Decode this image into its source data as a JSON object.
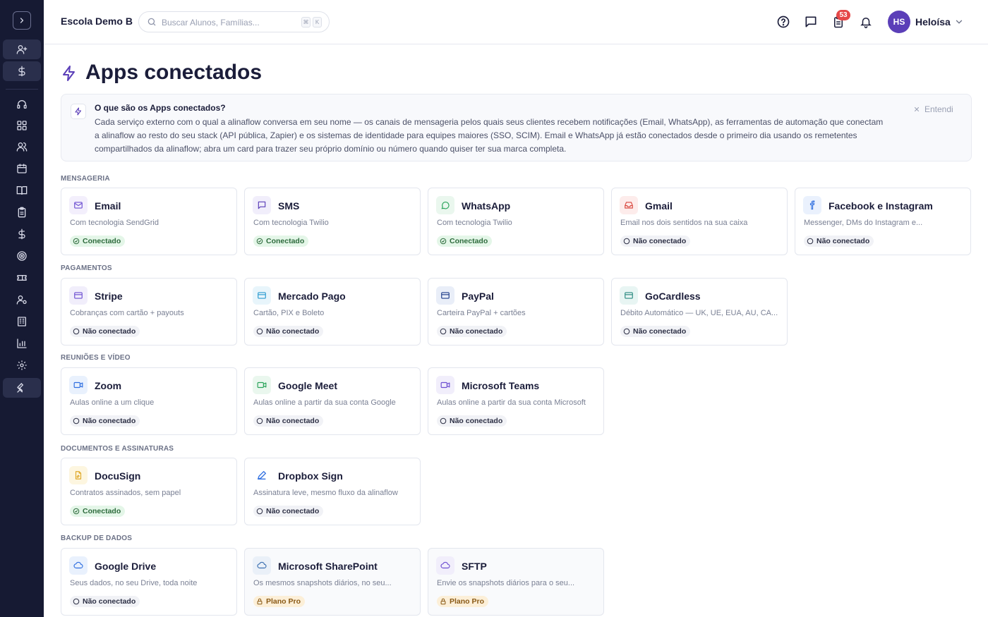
{
  "header": {
    "school_name": "Escola Demo B",
    "search_placeholder": "Buscar Alunos, Famílias...",
    "kbd1": "⌘",
    "kbd2": "K",
    "notification_count": "53",
    "avatar_initials": "HS",
    "user_name": "Heloísa"
  },
  "page": {
    "title": "Apps conectados"
  },
  "info": {
    "title": "O que são os Apps conectados?",
    "body": "Cada serviço externo com o qual a alinaflow conversa em seu nome — os canais de mensageria pelos quais seus clientes recebem notificações (Email, WhatsApp), as ferramentas de automação que conectam a alinaflow ao resto do seu stack (API pública, Zapier) e os sistemas de identidade para equipes maiores (SSO, SCIM). Email e WhatsApp já estão conectados desde o primeiro dia usando os remetentes compartilhados da alinaflow; abra um card para trazer seu próprio domínio ou número quando quiser ter sua marca completa.",
    "dismiss": "Entendi"
  },
  "sections": {
    "mensageria": "MENSAGERIA",
    "pagamentos": "PAGAMENTOS",
    "reunioes": "REUNIÕES E VÍDEO",
    "documentos": "DOCUMENTOS E ASSINATURAS",
    "backup": "BACKUP DE DADOS"
  },
  "status_labels": {
    "connected": "Conectado",
    "not_connected": "Não conectado",
    "pro": "Plano Pro"
  },
  "cards": {
    "email": {
      "name": "Email",
      "desc": "Com tecnologia SendGrid",
      "status": "Conectado"
    },
    "sms": {
      "name": "SMS",
      "desc": "Com tecnologia Twilio",
      "status": "Conectado"
    },
    "whatsapp": {
      "name": "WhatsApp",
      "desc": "Com tecnologia Twilio",
      "status": "Conectado"
    },
    "gmail": {
      "name": "Gmail",
      "desc": "Email nos dois sentidos na sua caixa",
      "status": "Não conectado"
    },
    "facebook": {
      "name": "Facebook e Instagram",
      "desc": "Messenger, DMs do Instagram e...",
      "status": "Não conectado"
    },
    "stripe": {
      "name": "Stripe",
      "desc": "Cobranças com cartão + payouts",
      "status": "Não conectado"
    },
    "mercado": {
      "name": "Mercado Pago",
      "desc": "Cartão, PIX e Boleto",
      "status": "Não conectado"
    },
    "paypal": {
      "name": "PayPal",
      "desc": "Carteira PayPal + cartões",
      "status": "Não conectado"
    },
    "gocardless": {
      "name": "GoCardless",
      "desc": "Débito Automático — UK, UE, EUA, AU, CA...",
      "status": "Não conectado"
    },
    "zoom": {
      "name": "Zoom",
      "desc": "Aulas online a um clique",
      "status": "Não conectado"
    },
    "meet": {
      "name": "Google Meet",
      "desc": "Aulas online a partir da sua conta Google",
      "status": "Não conectado"
    },
    "teams": {
      "name": "Microsoft Teams",
      "desc": "Aulas online a partir da sua conta Microsoft",
      "status": "Não conectado"
    },
    "docusign": {
      "name": "DocuSign",
      "desc": "Contratos assinados, sem papel",
      "status": "Conectado"
    },
    "dropbox": {
      "name": "Dropbox Sign",
      "desc": "Assinatura leve, mesmo fluxo da alinaflow",
      "status": "Não conectado"
    },
    "gdrive": {
      "name": "Google Drive",
      "desc": "Seus dados, no seu Drive, toda noite",
      "status": "Não conectado"
    },
    "sharepoint": {
      "name": "Microsoft SharePoint",
      "desc": "Os mesmos snapshots diários, no seu...",
      "status": "Plano Pro"
    },
    "sftp": {
      "name": "SFTP",
      "desc": "Envie os snapshots diários para o seu...",
      "status": "Plano Pro"
    }
  },
  "colors": {
    "sidebar_bg": "#161a33",
    "accent": "#5b3fb8",
    "connected_bg": "#e4f6e8",
    "pro_bg": "#fcefd8",
    "badge_red": "#e54848"
  }
}
